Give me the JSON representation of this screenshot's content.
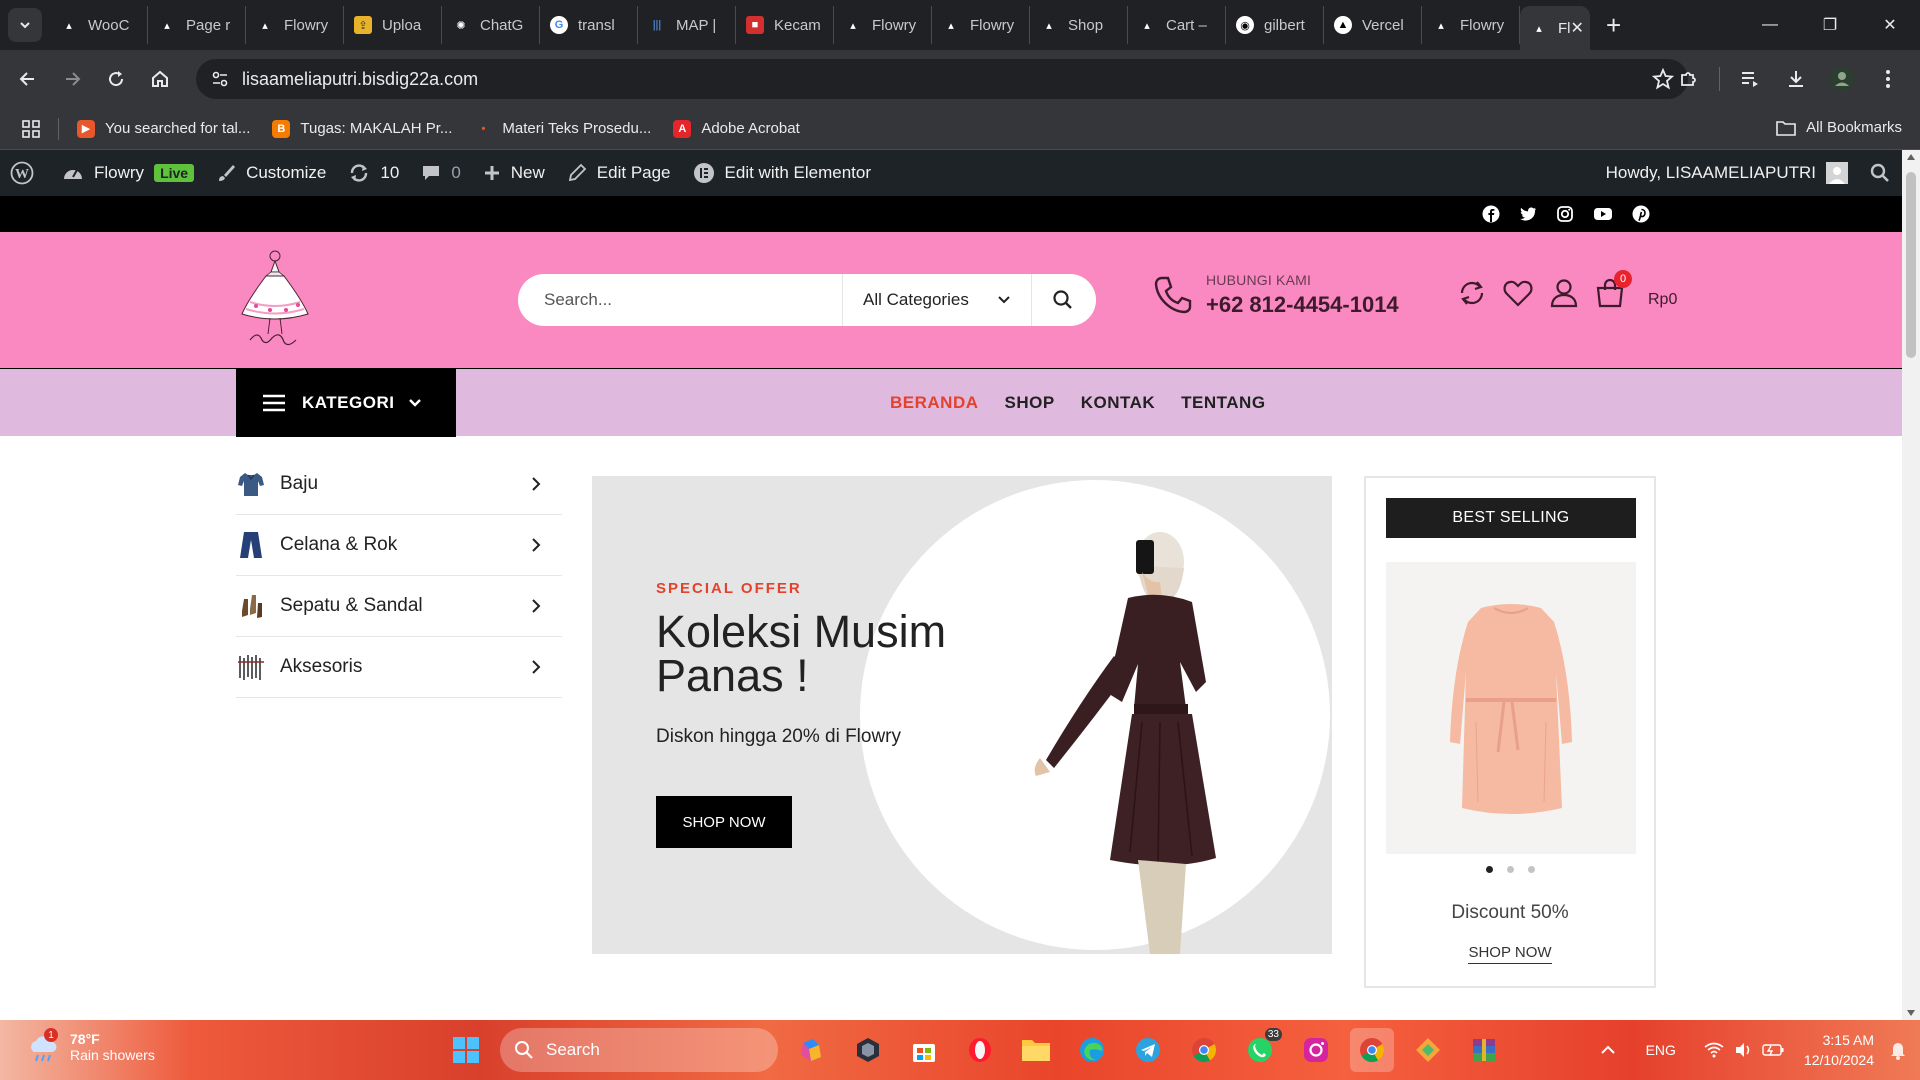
{
  "browser": {
    "tabs": [
      {
        "label": "WooC",
        "favicon": "flowry-icon"
      },
      {
        "label": "Page r",
        "favicon": "flowry-icon"
      },
      {
        "label": "Flowry",
        "favicon": "flowry-icon"
      },
      {
        "label": "Uploa",
        "favicon": "upload-icon"
      },
      {
        "label": "ChatG",
        "favicon": "chatgpt-icon"
      },
      {
        "label": "transl",
        "favicon": "google-icon"
      },
      {
        "label": "MAP |",
        "favicon": "map-icon"
      },
      {
        "label": "Kecam",
        "favicon": "news-icon"
      },
      {
        "label": "Flowry",
        "favicon": "flowry-icon"
      },
      {
        "label": "Flowry",
        "favicon": "flowry-icon"
      },
      {
        "label": "Shop",
        "favicon": "flowry-icon"
      },
      {
        "label": "Cart –",
        "favicon": "flowry-icon"
      },
      {
        "label": "gilbert",
        "favicon": "github-icon"
      },
      {
        "label": "Vercel",
        "favicon": "vercel-icon"
      },
      {
        "label": "Flowry",
        "favicon": "flowry-icon"
      }
    ],
    "active_tab": {
      "label": "Fl"
    },
    "url": "lisaameliaputri.bisdig22a.com",
    "bookmarks": [
      {
        "label": "You searched for tal...",
        "color": "#e8572b"
      },
      {
        "label": "Tugas: MAKALAH Pr...",
        "color": "#f57c00"
      },
      {
        "label": "Materi Teks Prosedu...",
        "color": "#e8572b"
      },
      {
        "label": "Adobe Acrobat",
        "color": "#e5252a"
      }
    ],
    "all_bookmarks": "All Bookmarks"
  },
  "wp_admin": {
    "site_name": "Flowry",
    "live_label": "Live",
    "customize": "Customize",
    "updates": "10",
    "comments": "0",
    "new": "New",
    "edit_page": "Edit Page",
    "elementor": "Edit with Elementor",
    "howdy": "Howdy, LISAAMELIAPUTRI"
  },
  "header": {
    "search_placeholder": "Search...",
    "category_select": "All Categories",
    "contact_label": "HUBUNGI KAMI",
    "contact_number": "+62 812-4454-1014",
    "cart_count": "0",
    "cart_total": "Rp0"
  },
  "nav": {
    "kategori": "KATEGORI",
    "items": [
      "BERANDA",
      "SHOP",
      "KONTAK",
      "TENTANG"
    ]
  },
  "categories": [
    "Baju",
    "Celana & Rok",
    "Sepatu & Sandal",
    "Aksesoris"
  ],
  "hero": {
    "kicker": "SPECIAL OFFER",
    "title": "Koleksi Musim Panas !",
    "subtitle": "Diskon hingga 20% di Flowry",
    "button": "SHOP NOW"
  },
  "best_selling": {
    "title": "BEST SELLING",
    "discount": "Discount 50%",
    "link": "SHOP NOW",
    "slide_count": 3,
    "active_slide": 1
  },
  "taskbar": {
    "temp": "78°F",
    "weather": "Rain showers",
    "search": "Search",
    "whatsapp_badge": "33",
    "lang": "ENG",
    "time": "3:15 AM",
    "date": "12/10/2024",
    "weather_badge": "1"
  },
  "colors": {
    "header_pink": "#f989c0",
    "nav_lilac": "#dfb9de",
    "accent_red": "#e4422c",
    "wp_bar": "#1d2327"
  }
}
